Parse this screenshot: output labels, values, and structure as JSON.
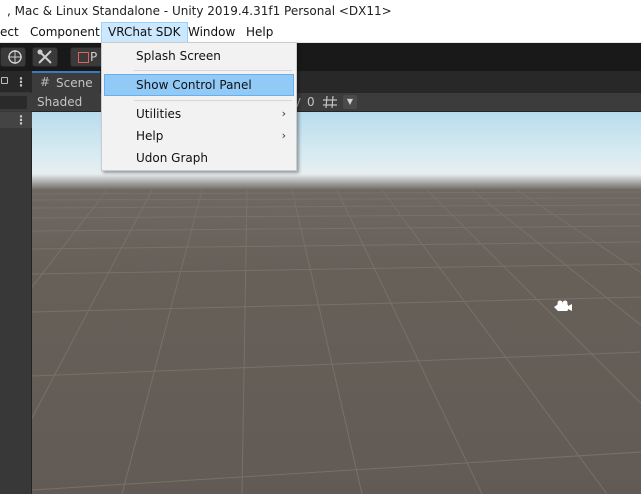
{
  "window": {
    "title": ", Mac & Linux Standalone - Unity 2019.4.31f1 Personal <DX11>"
  },
  "menubar": {
    "items": [
      {
        "label": "ect"
      },
      {
        "label": "Component"
      },
      {
        "label": "VRChat SDK",
        "open": true
      },
      {
        "label": "Window"
      },
      {
        "label": "Help"
      }
    ]
  },
  "toolbar": {
    "buttons": [
      {
        "icon": "pivot-icon"
      },
      {
        "icon": "tools-icon"
      },
      {
        "icon": "rect-select-icon",
        "label": "P"
      }
    ]
  },
  "hierarchy": {
    "menu_icon": "⋮"
  },
  "scene": {
    "tab_label": "Scene",
    "tab_icon": "#",
    "shading_mode": "Shaded",
    "hidden_count": "0",
    "grid_icon": "grid-icon"
  },
  "vrchat_menu": {
    "items": [
      {
        "label": "Splash Screen",
        "highlighted": false,
        "submenu": false
      },
      {
        "label": "Show Control Panel",
        "highlighted": true,
        "submenu": false
      },
      {
        "label": "Utilities",
        "highlighted": false,
        "submenu": true
      },
      {
        "label": "Help",
        "highlighted": false,
        "submenu": true
      },
      {
        "label": "Udon Graph",
        "highlighted": false,
        "submenu": false
      }
    ],
    "submenu_arrow": "›"
  },
  "colors": {
    "menu_highlight": "#91c9f7",
    "open_menu_bg": "#cce8ff",
    "scene_tab_accent": "#3a79bb",
    "ground": "#645d56",
    "sky": "#b9dced"
  }
}
